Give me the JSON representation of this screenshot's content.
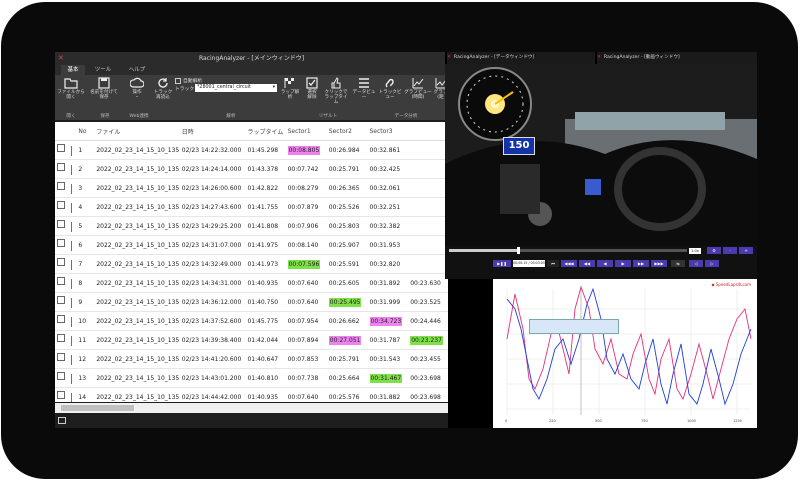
{
  "window": {
    "title": "RacingAnalyzer - [メインウィンドウ]"
  },
  "tabs": [
    "基本",
    "ツール",
    "ヘルプ"
  ],
  "ribbon": {
    "open_label": "ファイルから\n開く",
    "save_label": "名前を付けて\n保存",
    "web_label": "操作\n・",
    "reload_label": "トラック\n再読込",
    "auto_analysis": "自動解析",
    "track_label": "トラック",
    "track_value": "*28001_central_circuit",
    "lap_analysis_label": "ラップ解析",
    "select_release_label": "選択\n解除",
    "click_laptime_label": "クリックで\nラップタイム",
    "data_view_label": "データビュー",
    "track_view_label": "トラックビュー",
    "graph_time_label": "グラフビュー\n(時間)",
    "graph_dist_label": "グラフ\n(距",
    "groups": [
      "開く",
      "保存",
      "Web連携",
      "解析",
      "リザルト",
      "データ分析"
    ]
  },
  "table": {
    "headers": [
      "",
      "No",
      "ファイル",
      "日時",
      "ラップタイム",
      "Sector1",
      "Sector2",
      "Sector3",
      ""
    ],
    "rows": [
      {
        "no": "1",
        "file": "2022_02_23_14_15_10_135",
        "date": "02/23 14:22:32.000",
        "lap": "01:45.298",
        "s1": "00:08.805",
        "s2": "00:26.984",
        "s3": "00:32.861",
        "s4": "",
        "h1": "pink",
        "h2": "",
        "h3": "",
        "h4": ""
      },
      {
        "no": "2",
        "file": "2022_02_23_14_15_10_135",
        "date": "02/23 14:24:14.000",
        "lap": "01:43.378",
        "s1": "00:07.742",
        "s2": "00:25.791",
        "s3": "00:32.425",
        "s4": "",
        "h1": "",
        "h2": "",
        "h3": "",
        "h4": ""
      },
      {
        "no": "3",
        "file": "2022_02_23_14_15_10_135",
        "date": "02/23 14:26:00.600",
        "lap": "01:42.822",
        "s1": "00:08.279",
        "s2": "00:26.365",
        "s3": "00:32.061",
        "s4": "",
        "h1": "",
        "h2": "",
        "h3": "",
        "h4": ""
      },
      {
        "no": "4",
        "file": "2022_02_23_14_15_10_135",
        "date": "02/23 14:27:43.600",
        "lap": "01:41.755",
        "s1": "00:07.879",
        "s2": "00:25.526",
        "s3": "00:32.251",
        "s4": "",
        "h1": "",
        "h2": "",
        "h3": "",
        "h4": ""
      },
      {
        "no": "5",
        "file": "2022_02_23_14_15_10_135",
        "date": "02/23 14:29:25.200",
        "lap": "01:41.808",
        "s1": "00:07.906",
        "s2": "00:25.803",
        "s3": "00:32.382",
        "s4": "",
        "h1": "",
        "h2": "",
        "h3": "",
        "h4": ""
      },
      {
        "no": "6",
        "file": "2022_02_23_14_15_10_135",
        "date": "02/23 14:31:07.000",
        "lap": "01:41.975",
        "s1": "00:08.140",
        "s2": "00:25.907",
        "s3": "00:31.953",
        "s4": "",
        "h1": "",
        "h2": "",
        "h3": "",
        "h4": ""
      },
      {
        "no": "7",
        "file": "2022_02_23_14_15_10_135",
        "date": "02/23 14:32:49.000",
        "lap": "01:41.973",
        "s1": "00:07.596",
        "s2": "00:25.591",
        "s3": "00:32.820",
        "s4": "",
        "h1": "green",
        "h2": "",
        "h3": "",
        "h4": ""
      },
      {
        "no": "8",
        "file": "2022_02_23_14_15_10_135",
        "date": "02/23 14:34:31.000",
        "lap": "01:40.935",
        "s1": "00:07.640",
        "s2": "00:25.605",
        "s3": "00:31.892",
        "s4": "00:23.630",
        "h1": "",
        "h2": "",
        "h3": "",
        "h4": ""
      },
      {
        "no": "9",
        "file": "2022_02_23_14_15_10_135",
        "date": "02/23 14:36:12.000",
        "lap": "01:40.750",
        "s1": "00:07.640",
        "s2": "00:25.495",
        "s3": "00:31.999",
        "s4": "00:23.525",
        "h1": "",
        "h2": "green",
        "h3": "",
        "h4": ""
      },
      {
        "no": "10",
        "file": "2022_02_23_14_15_10_135",
        "date": "02/23 14:37:52.600",
        "lap": "01:45.775",
        "s1": "00:07.954",
        "s2": "00:26.662",
        "s3": "00:34.723",
        "s4": "00:24.446",
        "h1": "",
        "h2": "",
        "h3": "pink",
        "h4": ""
      },
      {
        "no": "11",
        "file": "2022_02_23_14_15_10_135",
        "date": "02/23 14:39:38.400",
        "lap": "01:42.044",
        "s1": "00:07.894",
        "s2": "00:27.051",
        "s3": "00:31.787",
        "s4": "00:23.237",
        "h1": "",
        "h2": "pink",
        "h3": "",
        "h4": "green"
      },
      {
        "no": "12",
        "file": "2022_02_23_14_15_10_135",
        "date": "02/23 14:41:20.600",
        "lap": "01:40.647",
        "s1": "00:07.853",
        "s2": "00:25.791",
        "s3": "00:31.543",
        "s4": "00:23.455",
        "h1": "",
        "h2": "",
        "h3": "",
        "h4": ""
      },
      {
        "no": "13",
        "file": "2022_02_23_14_15_10_135",
        "date": "02/23 14:43:01.200",
        "lap": "01:40.810",
        "s1": "00:07.738",
        "s2": "00:25.664",
        "s3": "00:31.467",
        "s4": "00:23.698",
        "h1": "",
        "h2": "",
        "h3": "green",
        "h4": ""
      },
      {
        "no": "14",
        "file": "2022_02_23_14_15_10_135",
        "date": "02/23 14:44:42.000",
        "lap": "01:40.935",
        "s1": "00:07.640",
        "s2": "00:25.576",
        "s3": "00:31.882",
        "s4": "00:23.698",
        "h1": "",
        "h2": "",
        "h3": "",
        "h4": ""
      }
    ]
  },
  "video": {
    "title_left": "RacingAnalyzer - [データウィンドウ]",
    "title_right": "RacingAnalyzer - [動画ウィンドウ]",
    "speed": "150",
    "timestamp": "00:00:15 / 00:03:05",
    "speed_rate": "1.0x"
  },
  "graph": {
    "legend": "SpeedLaps4Lcom"
  },
  "colors": {
    "pink": "#ee82ee",
    "green": "#7fe04a",
    "accent": "#4a3ab0",
    "blue_line": "#1f3fd8",
    "red_line": "#e8307a"
  }
}
